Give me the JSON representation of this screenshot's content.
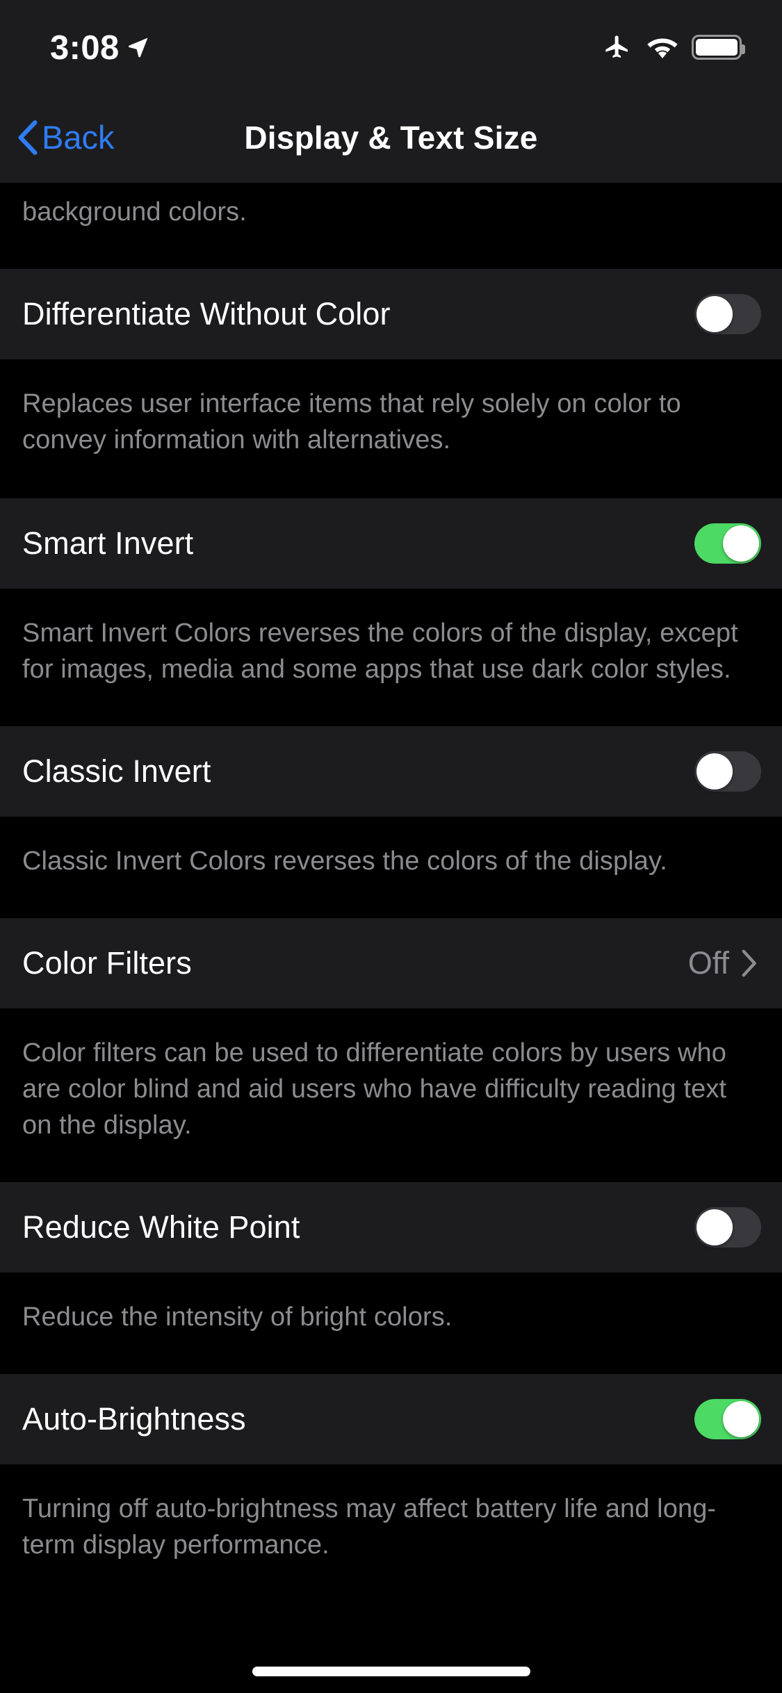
{
  "status_bar": {
    "time": "3:08",
    "icons": [
      "location-arrow-icon",
      "airplane-mode-icon",
      "wifi-icon",
      "battery-icon"
    ]
  },
  "nav": {
    "back_label": "Back",
    "title": "Display & Text Size"
  },
  "colors": {
    "accent_blue": "#2f7cf6",
    "switch_on_green": "#4cd964",
    "switch_off_track": "#39393d",
    "cell_background": "#1c1c1e",
    "page_background": "#000000",
    "secondary_text": "#8c8c90"
  },
  "content": {
    "partial_footer_top": "background colors.",
    "sections": [
      {
        "id": "differentiate-without-color",
        "type": "switch",
        "title": "Differentiate Without Color",
        "enabled": false,
        "footer": "Replaces user interface items that rely solely on color to convey information with alternatives."
      },
      {
        "id": "smart-invert",
        "type": "switch",
        "title": "Smart Invert",
        "enabled": true,
        "footer": "Smart Invert Colors reverses the colors of the display, except for images, media and some apps that use dark color styles."
      },
      {
        "id": "classic-invert",
        "type": "switch",
        "title": "Classic Invert",
        "enabled": false,
        "footer": "Classic Invert Colors reverses the colors of the display."
      },
      {
        "id": "color-filters",
        "type": "disclosure",
        "title": "Color Filters",
        "value": "Off",
        "footer": "Color filters can be used to differentiate colors by users who are color blind and aid users who have difficulty reading text on the display."
      },
      {
        "id": "reduce-white-point",
        "type": "switch",
        "title": "Reduce White Point",
        "enabled": false,
        "footer": "Reduce the intensity of bright colors."
      },
      {
        "id": "auto-brightness",
        "type": "switch",
        "title": "Auto-Brightness",
        "enabled": true,
        "footer": "Turning off auto-brightness may affect battery life and long-term display performance."
      }
    ]
  }
}
